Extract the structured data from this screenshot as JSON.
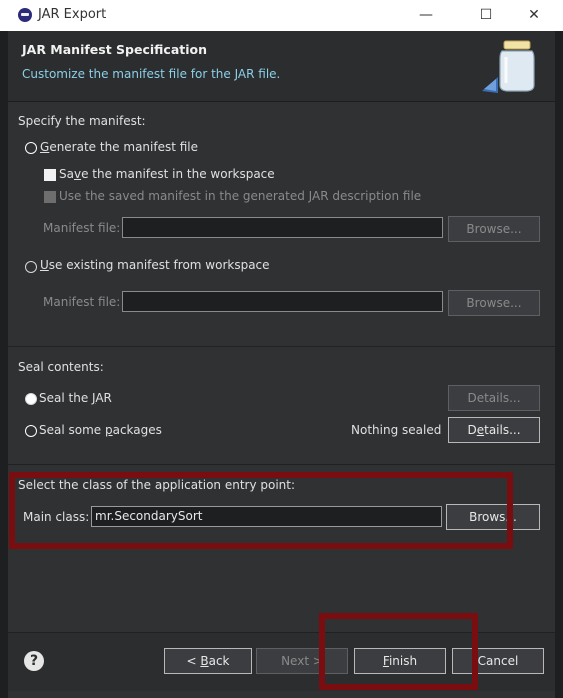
{
  "window": {
    "title": "JAR Export",
    "minimize": "—",
    "maximize": "☐",
    "close": "✕"
  },
  "header": {
    "title": "JAR Manifest Specification",
    "subtitle": "Customize the manifest file for the JAR file."
  },
  "manifest": {
    "section_label": "Specify the manifest:",
    "generate_option": "enerate the manifest file",
    "generate_mnemonic": "G",
    "save_option_pre": "Sa",
    "save_option_mnemonic": "v",
    "save_option_post": "e the manifest in the workspace",
    "use_saved_option": "Use the saved manifest in the generated JAR description file",
    "manifest_file_label": "Manifest file:",
    "manifest_file_value": "",
    "browse_label": "Browse...",
    "use_existing_option": "se existing manifest from workspace",
    "use_existing_mnemonic": "U",
    "manifest_file_label_2": "Manifest file:",
    "manifest_file_value_2": "",
    "browse_label_2": "Browse..."
  },
  "seal": {
    "section_label": "Seal contents:",
    "seal_jar_pre": "Seal the ",
    "seal_jar_mnemonic": "J",
    "seal_jar_post": "AR",
    "seal_packages_pre": "Seal some ",
    "seal_packages_mnemonic": "p",
    "seal_packages_post": "ackages",
    "details_label_1": "Details...",
    "nothing_sealed": "Nothing sealed",
    "details_label_2_pre": "D",
    "details_label_2_mnemonic": "e",
    "details_label_2_post": "tails..."
  },
  "entry": {
    "section_label": "Select the class of the application entry point:",
    "main_class_label": "Main class:",
    "main_class_value": "mr.SecondarySort",
    "browse_label": "Brows..."
  },
  "footer": {
    "help": "?",
    "back_pre": "< ",
    "back_mnemonic": "B",
    "back_post": "ack",
    "next_label": "Next >",
    "finish_mnemonic": "F",
    "finish_post": "inish",
    "cancel_label": "Cancel"
  },
  "colors": {
    "annotation": "#7a0d10",
    "subtitle": "#8ccfe8",
    "background": "#2f3133"
  }
}
